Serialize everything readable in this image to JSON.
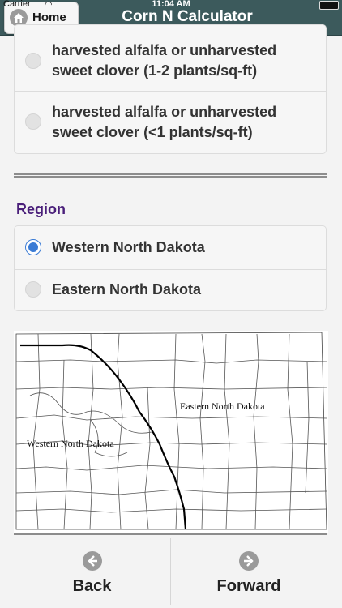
{
  "status_bar": {
    "carrier": "Carrier",
    "time": "11:04 AM"
  },
  "header": {
    "home_label": "Home",
    "title": "Corn N Calculator"
  },
  "previous_crop_options": [
    {
      "label": "harvested alfalfa or unharvested sweet clover (1-2 plants/sq-ft)",
      "selected": false
    },
    {
      "label": "harvested alfalfa or unharvested sweet clover (<1 plants/sq-ft)",
      "selected": false
    }
  ],
  "region": {
    "title": "Region",
    "options": [
      {
        "label": "Western North Dakota",
        "selected": true
      },
      {
        "label": "Eastern North Dakota",
        "selected": false
      }
    ]
  },
  "map": {
    "east_label": "Eastern North Dakota",
    "west_label": "Western North Dakota"
  },
  "footer": {
    "back_label": "Back",
    "forward_label": "Forward"
  },
  "colors": {
    "header_bg": "#3c5a5c",
    "accent": "#3a7bd5",
    "section_title": "#4a1f7a"
  }
}
